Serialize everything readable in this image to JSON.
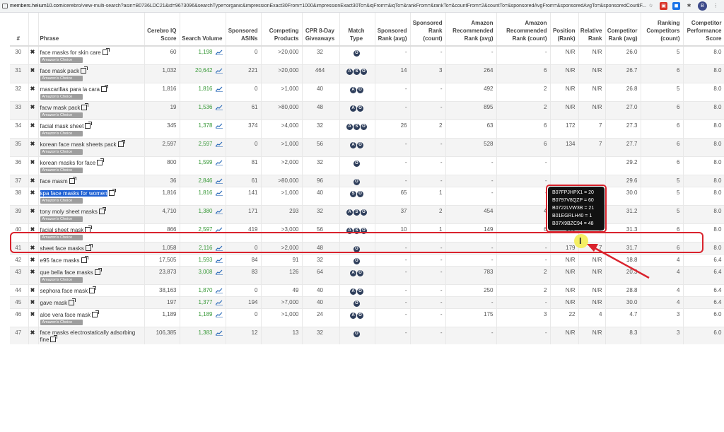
{
  "browser": {
    "url_host": "members.helium10.com",
    "url_rest": "/cerebro/view-multi-search?asin=B0736LDC21&id=9673096&searchType=organic&impressionExact30From=1000&impressionExact30To=&iqFrom=&iqTo=&rankFrom=&rankTo=&countFrom=2&countTo=&sponsoredAvgFrom=&sponsoredAvgTo=&sponsoredCountF...",
    "avatar_letter": "B"
  },
  "columns": [
    "#",
    "",
    "Phrase",
    "Cerebro IQ Score",
    "Search Volume",
    "Sponsored ASINs",
    "Competing Products",
    "CPR 8-Day Giveaways",
    "Match Type",
    "Sponsored Rank (avg)",
    "Sponsored Rank (count)",
    "Amazon Recommended Rank (avg)",
    "Amazon Recommended Rank (count)",
    "Position (Rank)",
    "Relative Rank",
    "Competitor Rank (avg)",
    "Ranking Competitors (count)",
    "Competitor Performance Score"
  ],
  "badge_label": "Amazon's Choice",
  "remove_mark": "✖",
  "rows": [
    {
      "n": "30",
      "phrase": "face masks for skin care",
      "badge": true,
      "iq": "60",
      "sv": "1,198",
      "sa": "0",
      "cp": ">20,000",
      "cpr": "32",
      "mt": [
        "O"
      ],
      "sra": "-",
      "src": "-",
      "ara": "-",
      "arc": "-",
      "pos": "N/R",
      "rel": "N/R",
      "cra": "26.0",
      "rc": "5",
      "cps": "8.0"
    },
    {
      "n": "31",
      "phrase": "face mask pack",
      "badge": true,
      "iq": "1,032",
      "sv": "20,642",
      "sa": "221",
      "cp": ">20,000",
      "cpr": "464",
      "mt": [
        "A",
        "S",
        "O"
      ],
      "sra": "14",
      "src": "3",
      "ara": "264",
      "arc": "6",
      "pos": "N/R",
      "rel": "N/R",
      "cra": "26.7",
      "rc": "6",
      "cps": "8.0"
    },
    {
      "n": "32",
      "phrase": "mascarillas para la cara",
      "badge": true,
      "iq": "1,816",
      "sv": "1,816",
      "sa": "0",
      "cp": ">1,000",
      "cpr": "40",
      "mt": [
        "A",
        "O"
      ],
      "sra": "-",
      "src": "-",
      "ara": "492",
      "arc": "2",
      "pos": "N/R",
      "rel": "N/R",
      "cra": "26.8",
      "rc": "5",
      "cps": "8.0"
    },
    {
      "n": "33",
      "phrase": "facw mask pack",
      "badge": true,
      "iq": "19",
      "sv": "1,536",
      "sa": "61",
      "cp": ">80,000",
      "cpr": "48",
      "mt": [
        "A",
        "O"
      ],
      "sra": "-",
      "src": "-",
      "ara": "895",
      "arc": "2",
      "pos": "N/R",
      "rel": "N/R",
      "cra": "27.0",
      "rc": "6",
      "cps": "8.0"
    },
    {
      "n": "34",
      "phrase": "facial mask sheet",
      "badge": true,
      "iq": "345",
      "sv": "1,378",
      "sa": "374",
      "cp": ">4,000",
      "cpr": "32",
      "mt": [
        "A",
        "S",
        "O"
      ],
      "sra": "26",
      "src": "2",
      "ara": "63",
      "arc": "6",
      "pos": "172",
      "rel": "7",
      "cra": "27.3",
      "rc": "6",
      "cps": "8.0"
    },
    {
      "n": "35",
      "phrase": "korean face mask sheets pack",
      "badge": true,
      "iq": "2,597",
      "sv": "2,597",
      "sa": "0",
      "cp": ">1,000",
      "cpr": "56",
      "mt": [
        "A",
        "O"
      ],
      "sra": "-",
      "src": "-",
      "ara": "528",
      "arc": "6",
      "pos": "134",
      "rel": "7",
      "cra": "27.7",
      "rc": "6",
      "cps": "8.0"
    },
    {
      "n": "36",
      "phrase": "korean masks for face",
      "badge": true,
      "iq": "800",
      "sv": "1,599",
      "sa": "81",
      "cp": ">2,000",
      "cpr": "32",
      "mt": [
        "O"
      ],
      "sra": "-",
      "src": "-",
      "ara": "-",
      "arc": "-",
      "pos": "",
      "rel": "",
      "cra": "29.2",
      "rc": "6",
      "cps": "8.0"
    },
    {
      "n": "37",
      "phrase": "face masm",
      "badge": false,
      "iq": "36",
      "sv": "2,846",
      "sa": "61",
      "cp": ">80,000",
      "cpr": "96",
      "mt": [
        "O"
      ],
      "sra": "-",
      "src": "-",
      "ara": "-",
      "arc": "-",
      "pos": "",
      "rel": "",
      "cra": "29.6",
      "rc": "5",
      "cps": "8.0"
    },
    {
      "n": "38",
      "phrase": "spa face masks for women",
      "badge": true,
      "sel": true,
      "iq": "1,816",
      "sv": "1,816",
      "sa": "141",
      "cp": ">1,000",
      "cpr": "40",
      "mt": [
        "S",
        "O"
      ],
      "sra": "65",
      "src": "1",
      "ara": "-",
      "arc": "-",
      "pos": "N/R",
      "rel": "N/R",
      "cra": "30.0",
      "rc": "5",
      "cps": "8.0"
    },
    {
      "n": "39",
      "phrase": "tony moly sheet masks",
      "badge": true,
      "iq": "4,710",
      "sv": "1,380",
      "sa": "171",
      "cp": "293",
      "cpr": "32",
      "mt": [
        "A",
        "S",
        "O"
      ],
      "sra": "37",
      "src": "2",
      "ara": "454",
      "arc": "4",
      "pos": "N/R",
      "rel": "N/R",
      "cra": "31.2",
      "rc": "5",
      "cps": "8.0"
    },
    {
      "n": "40",
      "phrase": "facial sheet mask",
      "badge": true,
      "iq": "866",
      "sv": "2,597",
      "sa": "419",
      "cp": ">3,000",
      "cpr": "56",
      "mt": [
        "A",
        "S",
        "O"
      ],
      "sra": "10",
      "src": "1",
      "ara": "149",
      "arc": "6",
      "pos": "160",
      "rel": "7",
      "cra": "31.3",
      "rc": "6",
      "cps": "8.0"
    },
    {
      "n": "41",
      "phrase": "sheet face masks",
      "badge": false,
      "iq": "1,058",
      "sv": "2,116",
      "sa": "0",
      "cp": ">2,000",
      "cpr": "48",
      "mt": [
        "O"
      ],
      "sra": "-",
      "src": "-",
      "ara": "-",
      "arc": "-",
      "pos": "179",
      "rel": "7",
      "cra": "31.7",
      "rc": "6",
      "cps": "8.0"
    },
    {
      "n": "42",
      "phrase": "e95 face masks",
      "badge": false,
      "iq": "17,505",
      "sv": "1,593",
      "sa": "84",
      "cp": "91",
      "cpr": "32",
      "mt": [
        "O"
      ],
      "sra": "-",
      "src": "-",
      "ara": "-",
      "arc": "-",
      "pos": "N/R",
      "rel": "N/R",
      "cra": "18.8",
      "rc": "4",
      "cps": "6.4"
    },
    {
      "n": "43",
      "phrase": "que bella face masks",
      "badge": true,
      "iq": "23,873",
      "sv": "3,008",
      "sa": "83",
      "cp": "126",
      "cpr": "64",
      "mt": [
        "A",
        "O"
      ],
      "sra": "-",
      "src": "-",
      "ara": "783",
      "arc": "2",
      "pos": "N/R",
      "rel": "N/R",
      "cra": "20.3",
      "rc": "4",
      "cps": "6.4"
    },
    {
      "n": "44",
      "phrase": "sephora face mask",
      "badge": false,
      "iq": "38,163",
      "sv": "1,870",
      "sa": "0",
      "cp": "49",
      "cpr": "40",
      "mt": [
        "A",
        "O"
      ],
      "sra": "-",
      "src": "-",
      "ara": "250",
      "arc": "2",
      "pos": "N/R",
      "rel": "N/R",
      "cra": "28.8",
      "rc": "4",
      "cps": "6.4"
    },
    {
      "n": "45",
      "phrase": "gave mask",
      "badge": false,
      "iq": "197",
      "sv": "1,377",
      "sa": "194",
      "cp": ">7,000",
      "cpr": "40",
      "mt": [
        "O"
      ],
      "sra": "-",
      "src": "-",
      "ara": "-",
      "arc": "-",
      "pos": "N/R",
      "rel": "N/R",
      "cra": "30.0",
      "rc": "4",
      "cps": "6.4"
    },
    {
      "n": "46",
      "phrase": "aloe vera face mask",
      "badge": true,
      "iq": "1,189",
      "sv": "1,189",
      "sa": "0",
      "cp": ">1,000",
      "cpr": "24",
      "mt": [
        "A",
        "O"
      ],
      "sra": "-",
      "src": "-",
      "ara": "175",
      "arc": "3",
      "pos": "22",
      "rel": "4",
      "cra": "4.7",
      "rc": "3",
      "cps": "6.0"
    },
    {
      "n": "47",
      "phrase": "face masks electrostatically adsorbing fine",
      "badge": false,
      "iq": "106,385",
      "sv": "1,383",
      "sa": "12",
      "cp": "13",
      "cpr": "32",
      "mt": [
        "O"
      ],
      "sra": "-",
      "src": "-",
      "ara": "-",
      "arc": "-",
      "pos": "N/R",
      "rel": "N/R",
      "cra": "8.3",
      "rc": "3",
      "cps": "6.0"
    }
  ],
  "tooltip": [
    "B07FPJHPX1 = 20",
    "B0797V8QZP = 60",
    "B0722LVW3B = 21",
    "B01EGRLH40 = 1",
    "B07X9BZC94 = 48"
  ],
  "colors": {
    "highlight": "#d9232d",
    "search_volume": "#3a9a3a",
    "selection": "#1c5fd3"
  }
}
